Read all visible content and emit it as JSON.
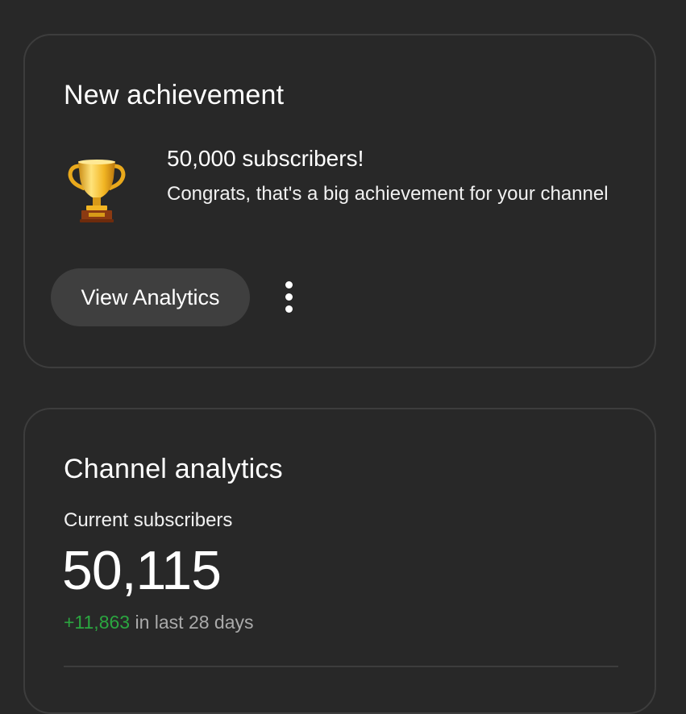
{
  "achievement_card": {
    "title": "New achievement",
    "icon": "trophy-icon",
    "heading": "50,000 subscribers!",
    "body": "Congrats, that's a big achievement for your channel",
    "primary_button": "View Analytics",
    "more_icon": "more-vert-icon"
  },
  "analytics_card": {
    "title": "Channel analytics",
    "metric_label": "Current subscribers",
    "metric_value": "50,115",
    "change_value": "+11,863",
    "change_period": "in last 28 days"
  },
  "colors": {
    "background": "#282828",
    "card_border": "#3d3d3d",
    "button_bg": "#3f3f3f",
    "positive": "#2ba640",
    "secondary_text": "#aaaaaa"
  }
}
